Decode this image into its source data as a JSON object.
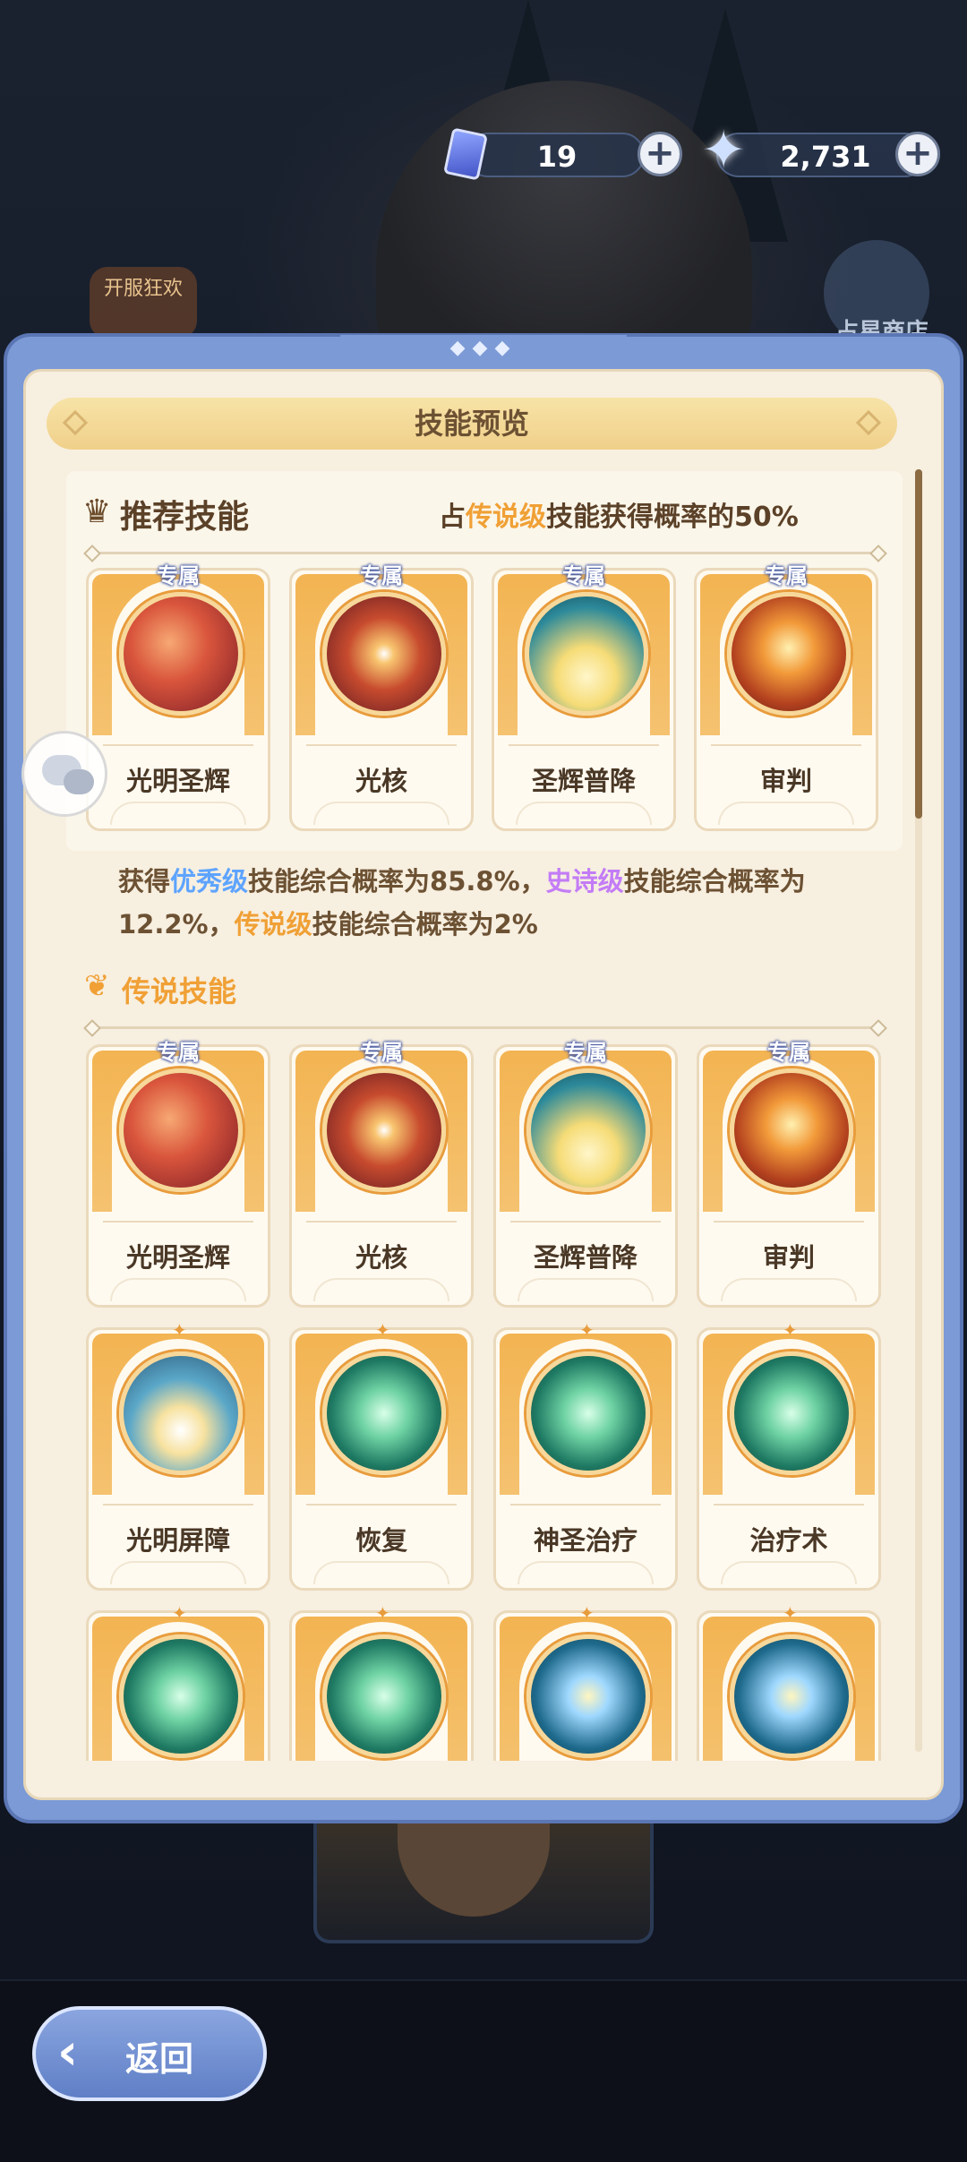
{
  "topbar": {
    "ticket_value": "19",
    "crystal_value": "2,731",
    "event_label": "开服狂欢",
    "shop_label": "占星商店"
  },
  "panel": {
    "title": "技能预览"
  },
  "recommended": {
    "title": "推荐技能",
    "note_prefix": "占",
    "note_highlight": "传说级",
    "note_suffix": "技能获得概率的50%",
    "skills": [
      {
        "name": "光明圣辉",
        "badge": "专属"
      },
      {
        "name": "光核",
        "badge": "专属"
      },
      {
        "name": "圣辉普降",
        "badge": "专属"
      },
      {
        "name": "审判",
        "badge": "专属"
      }
    ]
  },
  "probability": {
    "p1": "获得",
    "excellent": "优秀级",
    "p2": "技能综合概率为85.8%，",
    "epic": "史诗级",
    "p3": "技能综合概率为12.2%，",
    "legend": "传说级",
    "p4": "技能综合概率为2%"
  },
  "legendary": {
    "title": "传说技能",
    "skills": [
      {
        "name": "光明圣辉",
        "badge": "专属"
      },
      {
        "name": "光核",
        "badge": "专属"
      },
      {
        "name": "圣辉普降",
        "badge": "专属"
      },
      {
        "name": "审判",
        "badge": "专属"
      },
      {
        "name": "光明屏障",
        "badge": ""
      },
      {
        "name": "恢复",
        "badge": ""
      },
      {
        "name": "神圣治疗",
        "badge": ""
      },
      {
        "name": "治疗术",
        "badge": ""
      },
      {
        "name": "",
        "badge": ""
      },
      {
        "name": "",
        "badge": ""
      },
      {
        "name": "",
        "badge": ""
      },
      {
        "name": "",
        "badge": ""
      }
    ]
  },
  "footer": {
    "back_label": "返回"
  },
  "colors": {
    "accent_orange": "#f0a035",
    "excellent_blue": "#5ea4ff",
    "epic_purple": "#c37cf6",
    "panel_blue": "#7c9ad6"
  }
}
